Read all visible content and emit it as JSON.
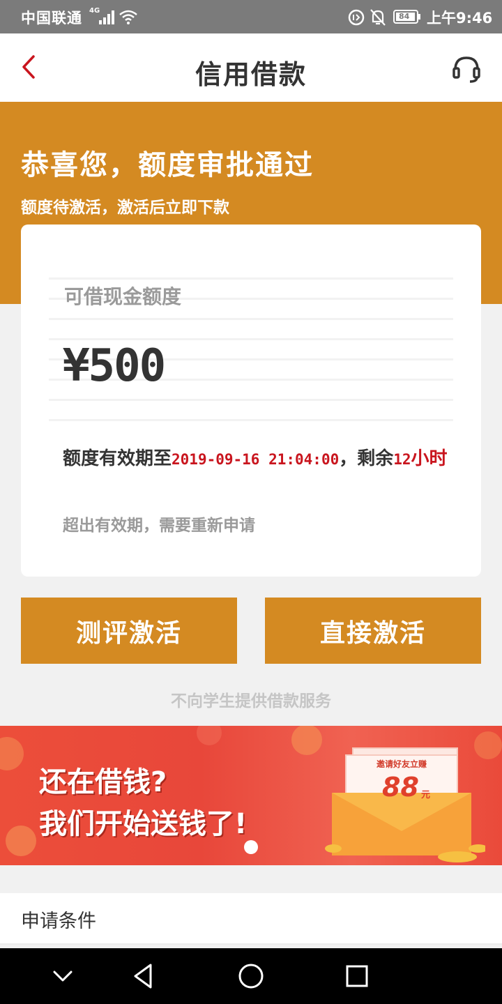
{
  "status_bar": {
    "carrier": "中国联通",
    "network": "4G",
    "battery": "84",
    "time": "上午9:46"
  },
  "header": {
    "title": "信用借款"
  },
  "banner": {
    "congrats": "恭喜您，额度审批通过",
    "note": "额度待激活，激活后立即下款"
  },
  "card": {
    "limit_label": "可借现金额度",
    "amount": "¥500",
    "validity_prefix": "额度有效期至",
    "validity_datetime": "2019-09-16 21:04:00",
    "validity_mid": "，剩余",
    "remaining_number": "12",
    "remaining_unit": "小时",
    "expire_note": "超出有效期，需要重新申请"
  },
  "actions": {
    "eval_label": "测评激活",
    "direct_label": "直接激活"
  },
  "student_note": "不向学生提供借款服务",
  "promo": {
    "line1": "还在借钱?",
    "line2": "我们开始送钱了!",
    "envelope_invite": "邀请好友立赚",
    "envelope_amount": "88",
    "envelope_unit": "元"
  },
  "conditions_label": "申请条件",
  "colors": {
    "accent": "#d48a22",
    "highlight_red": "#c9151e",
    "promo_red": "#ea4a3a"
  }
}
